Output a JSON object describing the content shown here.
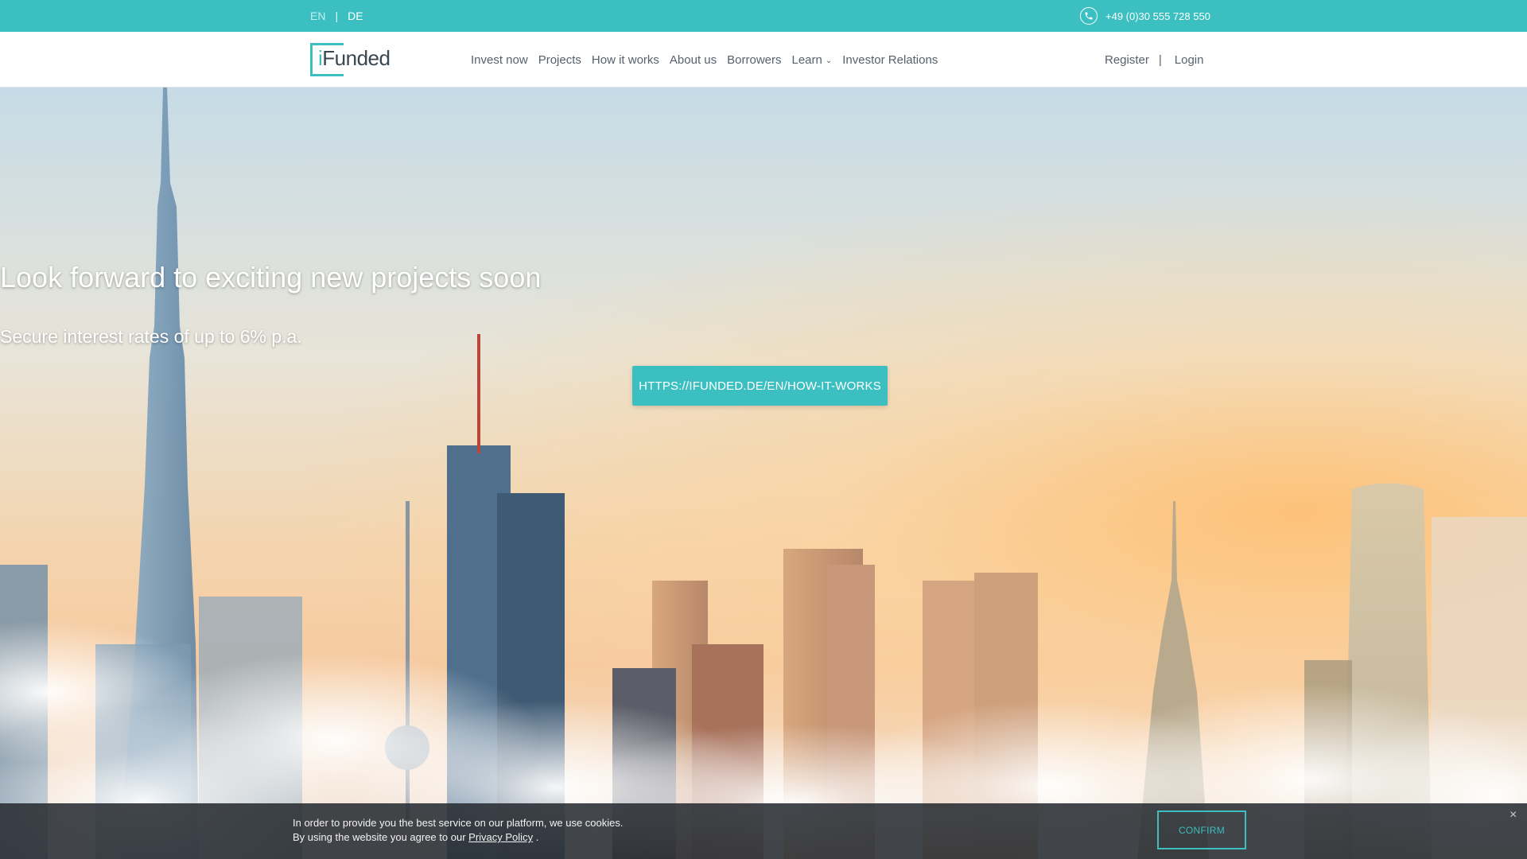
{
  "topbar": {
    "lang_en": "EN",
    "lang_sep": "|",
    "lang_de": "DE",
    "phone": "+49 (0)30 555 728 550",
    "phone_icon": "phone-icon"
  },
  "logo": {
    "prefix": "i",
    "rest": "Funded"
  },
  "nav": {
    "items": [
      {
        "label": "Invest now"
      },
      {
        "label": "Projects"
      },
      {
        "label": "How it works"
      },
      {
        "label": "About us"
      },
      {
        "label": "Borrowers"
      },
      {
        "label": "Learn"
      },
      {
        "label": "Investor Relations"
      }
    ],
    "register": "Register",
    "auth_sep": "|",
    "login": "Login"
  },
  "hero": {
    "title": "Look forward to exciting new projects soon",
    "subtitle": "Secure interest rates of up to 6% p.a.",
    "button": "HTTPS://IFUNDED.DE/EN/HOW-IT-WORKS"
  },
  "cookie": {
    "line1": "In order to provide you the best service on our platform, we use cookies.",
    "line2_prefix": "By using the website you agree to our",
    "link": "Privacy Policy",
    "line2_suffix": ".",
    "confirm": "CONFIRM",
    "close": "×"
  },
  "colors": {
    "accent": "#3bbfc0",
    "nav_text": "#56616c",
    "cookie_bg": "#282c32"
  }
}
